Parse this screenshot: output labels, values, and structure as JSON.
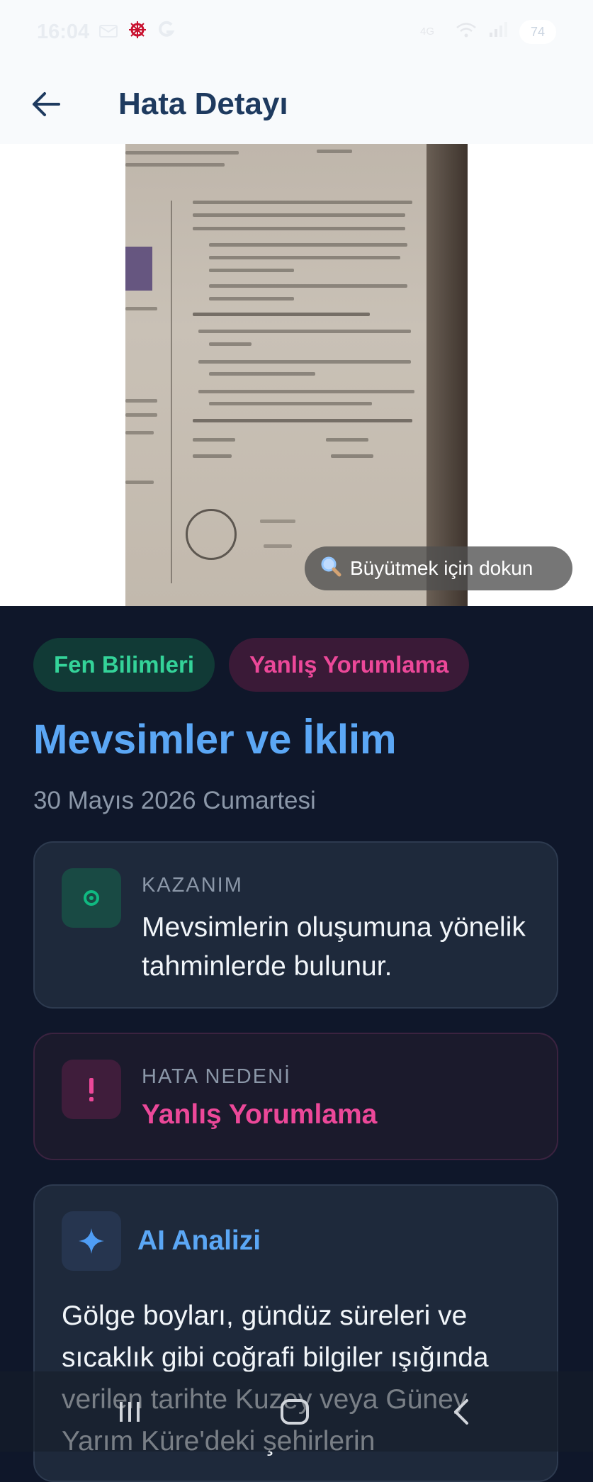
{
  "status_bar": {
    "time": "16:04",
    "battery": "74"
  },
  "header": {
    "title": "Hata Detayı"
  },
  "photo": {
    "zoom_hint": "Büyütmek için dokun"
  },
  "tags": [
    {
      "label": "Fen Bilimleri",
      "color": "#34d399"
    },
    {
      "label": "Yanlış Yorumlama",
      "color": "#ec4899"
    }
  ],
  "topic": "Mevsimler ve İklim",
  "date": "30 Mayıs 2026 Cumartesi",
  "kazanim": {
    "label": "KAZANIM",
    "text": "Mevsimlerin oluşumuna yönelik tahminlerde bulunur."
  },
  "hata": {
    "label": "HATA NEDENİ",
    "reason": "Yanlış Yorumlama"
  },
  "ai": {
    "title": "AI Analizi",
    "text": "Gölge boyları, gündüz süreleri ve sıcaklık gibi coğrafi bilgiler ışığında verilen tarihte Kuzey veya Güney Yarım Küre'deki şehirlerin"
  }
}
